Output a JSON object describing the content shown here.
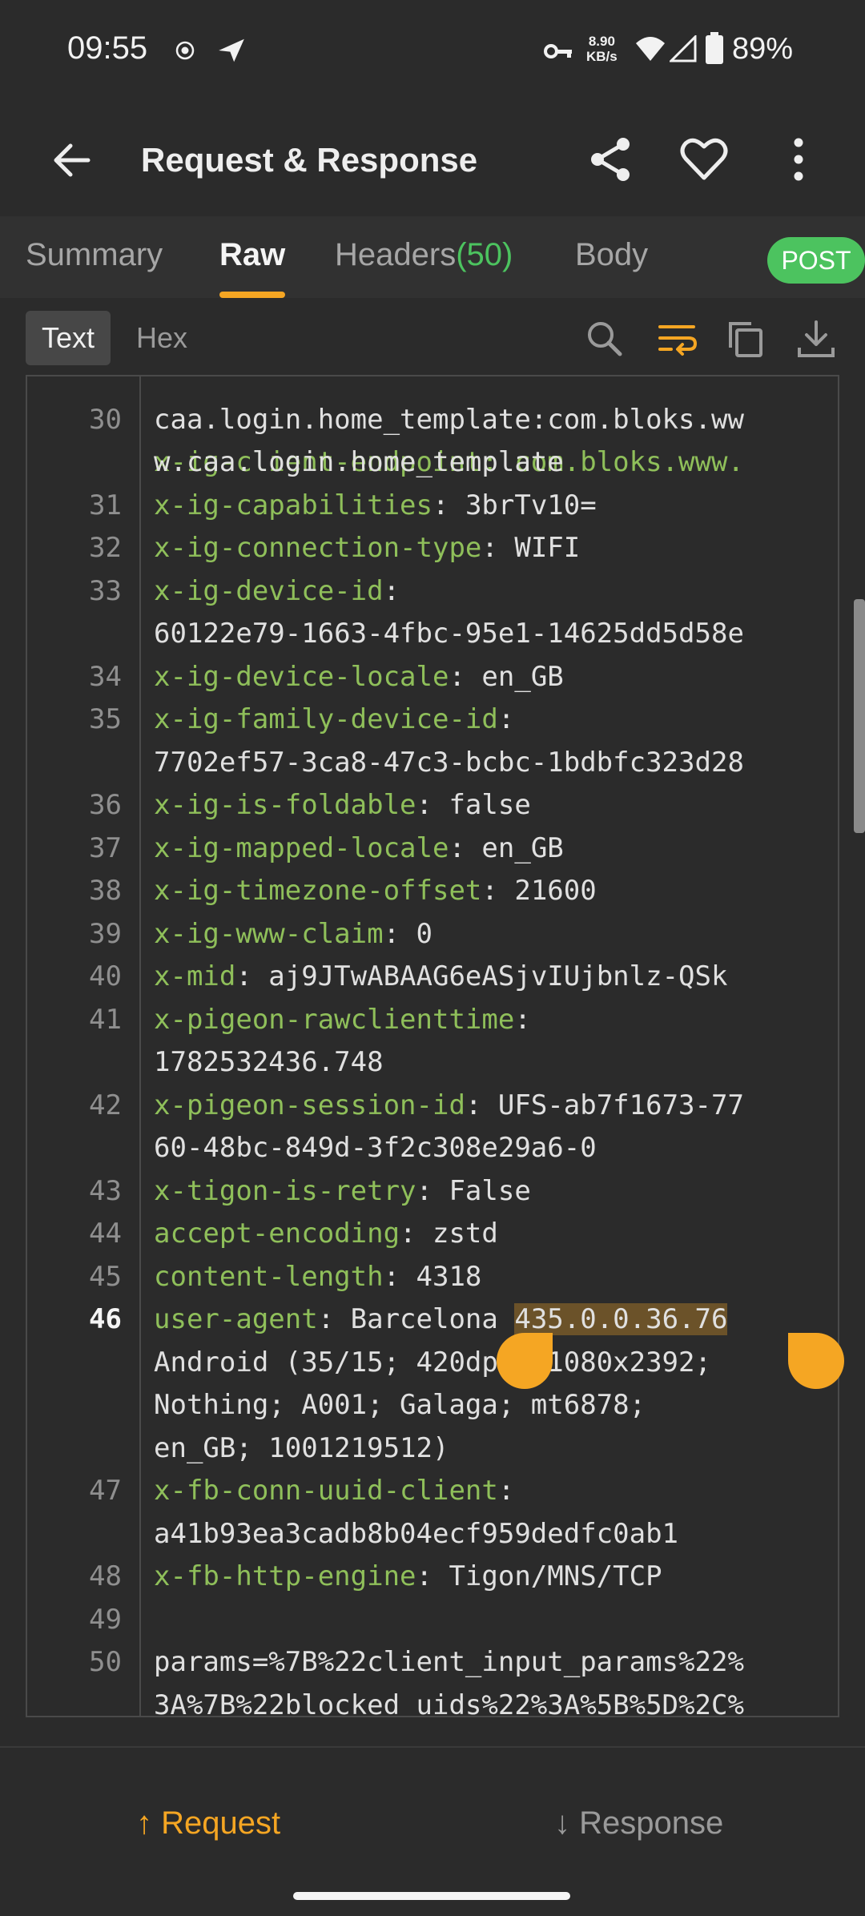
{
  "status_bar": {
    "time": "09:55",
    "net_speed_value": "8.90",
    "net_speed_unit": "KB/s",
    "battery": "89%"
  },
  "app_bar": {
    "title": "Request & Response"
  },
  "tabs": {
    "summary": "Summary",
    "raw": "Raw",
    "headers": "Headers",
    "headers_count": "(50)",
    "body": "Body",
    "method_badge": "POST"
  },
  "view_toggle": {
    "text": "Text",
    "hex": "Hex"
  },
  "code": {
    "line_29_cont": "x-ig-client-endpoint: com.bloks.www.",
    "line_29_cont_num": "30",
    "rows": [
      {
        "n": "",
        "k": "",
        "v": "caa.login.home_template:com.bloks.ww"
      },
      {
        "n": "",
        "k": "",
        "v": "w.caa.login.home_template"
      },
      {
        "n": "31",
        "k": "x-ig-capabilities",
        "v": ": 3brTv10="
      },
      {
        "n": "32",
        "k": "x-ig-connection-type",
        "v": ": WIFI"
      },
      {
        "n": "33",
        "k": "x-ig-device-id",
        "v": ":"
      },
      {
        "n": "",
        "k": "",
        "v": "60122e79-1663-4fbc-95e1-14625dd5d58e"
      },
      {
        "n": "34",
        "k": "x-ig-device-locale",
        "v": ": en_GB"
      },
      {
        "n": "35",
        "k": "x-ig-family-device-id",
        "v": ":"
      },
      {
        "n": "",
        "k": "",
        "v": "7702ef57-3ca8-47c3-bcbc-1bdbfc323d28"
      },
      {
        "n": "36",
        "k": "x-ig-is-foldable",
        "v": ": false"
      },
      {
        "n": "37",
        "k": "x-ig-mapped-locale",
        "v": ": en_GB"
      },
      {
        "n": "38",
        "k": "x-ig-timezone-offset",
        "v": ": 21600"
      },
      {
        "n": "39",
        "k": "x-ig-www-claim",
        "v": ": 0"
      },
      {
        "n": "40",
        "k": "x-mid",
        "v": ": aj9JTwABAAG6eASjvIUjbnlz-QSk"
      },
      {
        "n": "41",
        "k": "x-pigeon-rawclienttime",
        "v": ":"
      },
      {
        "n": "",
        "k": "",
        "v": "1782532436.748"
      },
      {
        "n": "42",
        "k": "x-pigeon-session-id",
        "v": ": UFS-ab7f1673-77"
      },
      {
        "n": "",
        "k": "",
        "v": "60-48bc-849d-3f2c308e29a6-0"
      },
      {
        "n": "43",
        "k": "x-tigon-is-retry",
        "v": ": False"
      },
      {
        "n": "44",
        "k": "accept-encoding",
        "v": ": zstd"
      },
      {
        "n": "45",
        "k": "content-length",
        "v": ": 4318"
      },
      {
        "n": "46",
        "k": "user-agent",
        "v": ": Barcelona ",
        "sel": "435.0.0.36.76",
        "current": true
      },
      {
        "n": "",
        "k": "",
        "v": "Android (35/15; 420dpi; 1080x2392;"
      },
      {
        "n": "",
        "k": "",
        "v": "Nothing; A001; Galaga; mt6878;"
      },
      {
        "n": "",
        "k": "",
        "v": "en_GB; 1001219512)"
      },
      {
        "n": "47",
        "k": "x-fb-conn-uuid-client",
        "v": ":"
      },
      {
        "n": "",
        "k": "",
        "v": "a41b93ea3cadb8b04ecf959dedfc0ab1"
      },
      {
        "n": "48",
        "k": "x-fb-http-engine",
        "v": ": Tigon/MNS/TCP"
      },
      {
        "n": "49",
        "k": "",
        "v": ""
      },
      {
        "n": "50",
        "k": "",
        "v": "params=%7B%22client_input_params%22%"
      },
      {
        "n": "",
        "k": "",
        "v": "3A%7B%22blocked_uids%22%3A%5B%5D%2C%"
      }
    ]
  },
  "bottom_nav": {
    "request": "Request",
    "response": "Response"
  },
  "colors": {
    "accent": "#f5a623",
    "key_green": "#8fbf5a",
    "badge_green": "#4cc35f",
    "background": "#2b2b2b"
  }
}
